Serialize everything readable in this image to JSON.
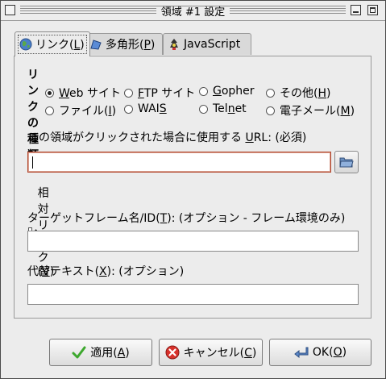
{
  "window": {
    "title": "領域 #1 設定"
  },
  "tabs": [
    {
      "label": "リンク(",
      "mnemonic": "L",
      "suffix": ")",
      "icon": "globe-icon"
    },
    {
      "label": "多角形(",
      "mnemonic": "P",
      "suffix": ")",
      "icon": "polygon-icon"
    },
    {
      "label": "JavaScript",
      "icon": "javascript-icon"
    }
  ],
  "link_type": {
    "heading": "リンクの種類",
    "options": [
      {
        "pre": "",
        "mn": "W",
        "post": "eb サイト",
        "checked": true
      },
      {
        "pre": "",
        "mn": "F",
        "post": "TP サイト",
        "checked": false
      },
      {
        "pre": "",
        "mn": "G",
        "post": "opher",
        "checked": false
      },
      {
        "pre": "その他(",
        "mn": "H",
        "post": ")",
        "checked": false
      },
      {
        "pre": "ファイル(",
        "mn": "I",
        "post": ")",
        "checked": false
      },
      {
        "pre": "WAI",
        "mn": "S",
        "post": "",
        "checked": false
      },
      {
        "pre": "Tel",
        "mn": "n",
        "post": "et",
        "checked": false
      },
      {
        "pre": "電子メール(",
        "mn": "M",
        "post": ")",
        "checked": false
      }
    ]
  },
  "url": {
    "label_pre": "この領域がクリックされた場合に使用する ",
    "label_mn": "U",
    "label_post": "RL: (必須)",
    "value": ""
  },
  "relative": {
    "pre": "相対リンク(",
    "mn": "V",
    "post": ")",
    "checked": true
  },
  "target": {
    "label_pre": "ターゲットフレーム名/ID(",
    "label_mn": "T",
    "label_post": "): (オプション - フレーム環境のみ)",
    "value": ""
  },
  "alt": {
    "label_pre": "代替テキスト(",
    "label_mn": "X",
    "label_post": "): (オプション)",
    "value": ""
  },
  "buttons": {
    "apply": {
      "pre": "適用(",
      "mn": "A",
      "post": ")"
    },
    "cancel": {
      "pre": "キャンセル(",
      "mn": "C",
      "post": ")"
    },
    "ok": {
      "pre": "OK(",
      "mn": "O",
      "post": ")"
    }
  },
  "colors": {
    "focus_border": "#b2452b",
    "background": "#ececec"
  }
}
